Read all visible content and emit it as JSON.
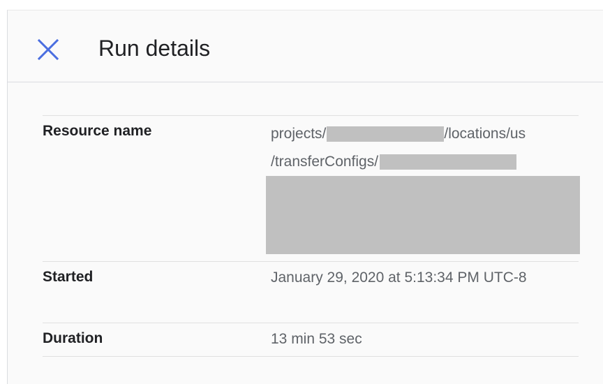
{
  "panel": {
    "title": "Run details",
    "close_icon": "close-icon"
  },
  "details": {
    "resource_name": {
      "label": "Resource name",
      "prefix": "projects/",
      "middle": "/locations/us",
      "line2": "/transferConfigs/"
    },
    "started": {
      "label": "Started",
      "value": "January 29, 2020 at 5:13:34 PM UTC-8"
    },
    "duration": {
      "label": "Duration",
      "value": "13 min 53 sec"
    }
  },
  "colors": {
    "accent": "#4a6ee0",
    "redaction": "#c0c0c0"
  }
}
